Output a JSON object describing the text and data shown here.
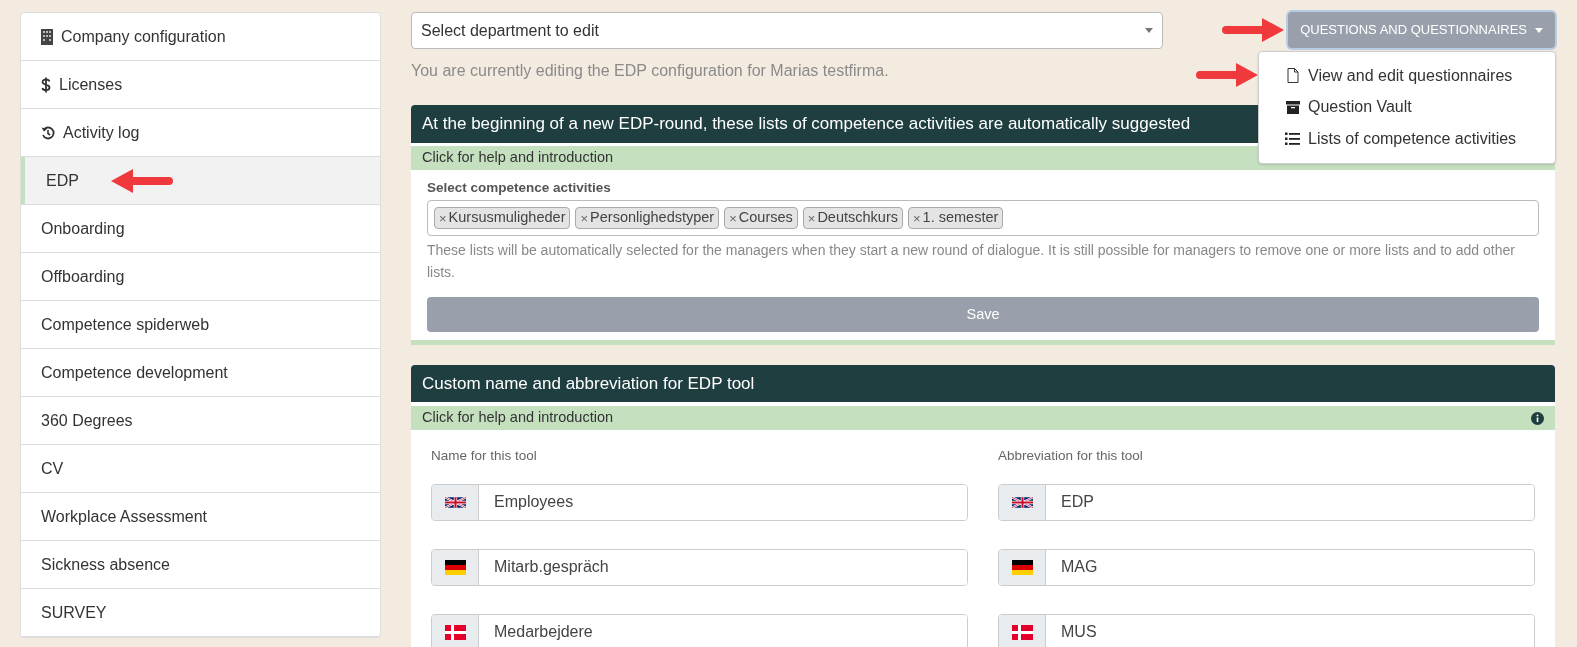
{
  "sidebar": {
    "items": [
      {
        "label": "Company configuration",
        "kind": "building",
        "selected": false
      },
      {
        "label": "Licenses",
        "kind": "dollar",
        "selected": false
      },
      {
        "label": "Activity log",
        "kind": "history",
        "selected": false
      },
      {
        "label": "EDP",
        "selected": true
      },
      {
        "label": "Onboarding",
        "selected": false
      },
      {
        "label": "Offboarding",
        "selected": false
      },
      {
        "label": "Competence spiderweb",
        "selected": false
      },
      {
        "label": "Competence development",
        "selected": false
      },
      {
        "label": "360 Degrees",
        "selected": false
      },
      {
        "label": "CV",
        "selected": false
      },
      {
        "label": "Workplace Assessment",
        "selected": false
      },
      {
        "label": "Sickness absence",
        "selected": false
      },
      {
        "label": "SURVEY",
        "selected": false
      }
    ]
  },
  "department_select": {
    "placeholder": "Select department to edit"
  },
  "editing_note": "You are currently editing the EDP configuration for Marias testfirma.",
  "menu_button": {
    "label": "QUESTIONS AND QUESTIONNAIRES",
    "expanded": true
  },
  "menu": {
    "items": [
      {
        "label": "View and edit questionnaires",
        "kind": "file"
      },
      {
        "label": "Question Vault",
        "kind": "archive"
      },
      {
        "label": "Lists of competence activities",
        "kind": "list"
      }
    ]
  },
  "suggested_panel": {
    "title": "At the beginning of a new EDP-round, these lists of competence activities are automatically suggested",
    "help": "Click for help and introduction",
    "field_label": "Select competence activities",
    "tags": [
      {
        "remove": "×",
        "label": "Kursusmuligheder"
      },
      {
        "remove": "×",
        "label": "Personlighedstyper"
      },
      {
        "remove": "×",
        "label": "Courses"
      },
      {
        "remove": "×",
        "label": "Deutschkurs"
      },
      {
        "remove": "×",
        "label": "1. semester"
      }
    ],
    "hint": "These lists will be automatically selected for the managers when they start a new round of dialogue. It is still possible for managers to remove one or more lists and to add other lists.",
    "save_button": "Save"
  },
  "name_panel": {
    "title": "Custom name and abbreviation for EDP tool",
    "help": "Click for help and introduction",
    "columns": [
      "Name for this tool",
      "Abbreviation for this tool"
    ],
    "rows": [
      {
        "kind": "uk",
        "name": "Employees",
        "abbreviation": "EDP"
      },
      {
        "kind": "de",
        "name": "Mitarb.gespräch",
        "abbreviation": "MAG"
      },
      {
        "kind": "dk",
        "name": "Medarbejdere",
        "abbreviation": "MUS"
      }
    ]
  }
}
